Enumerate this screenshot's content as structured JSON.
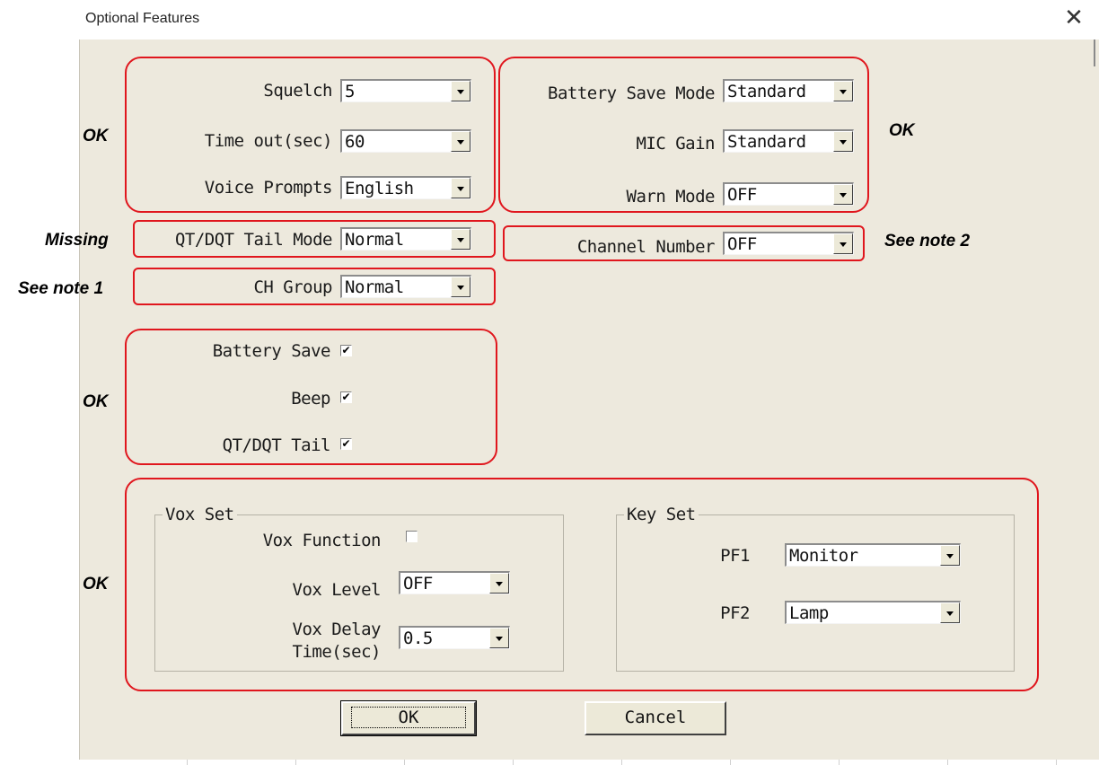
{
  "window": {
    "title": "Optional Features",
    "close_symbol": "✕"
  },
  "fields": {
    "squelch": {
      "label": "Squelch",
      "value": "5"
    },
    "timeout": {
      "label": "Time out(sec)",
      "value": "60"
    },
    "voice_prompts": {
      "label": "Voice Prompts",
      "value": "English"
    },
    "qt_tail_mode": {
      "label": "QT/DQT Tail Mode",
      "value": "Normal"
    },
    "ch_group": {
      "label": "CH Group",
      "value": "Normal"
    },
    "battery_save_mode": {
      "label": "Battery Save Mode",
      "value": "Standard"
    },
    "mic_gain": {
      "label": "MIC Gain",
      "value": "Standard"
    },
    "warn_mode": {
      "label": "Warn Mode",
      "value": "OFF"
    },
    "channel_number": {
      "label": "Channel Number",
      "value": "OFF"
    }
  },
  "checkboxes": {
    "battery_save": {
      "label": "Battery Save",
      "checked": true
    },
    "beep": {
      "label": "Beep",
      "checked": true
    },
    "qt_tail": {
      "label": "QT/DQT Tail",
      "checked": true
    }
  },
  "vox_set": {
    "legend": "Vox Set",
    "vox_function": {
      "label": "Vox Function",
      "checked": false
    },
    "vox_level": {
      "label": "Vox Level",
      "value": "OFF"
    },
    "vox_delay": {
      "label_line1": "Vox Delay",
      "label_line2": "Time(sec)",
      "value": "0.5"
    }
  },
  "key_set": {
    "legend": "Key Set",
    "pf1": {
      "label": "PF1",
      "value": "Monitor"
    },
    "pf2": {
      "label": "PF2",
      "value": "Lamp"
    }
  },
  "buttons": {
    "ok": "OK",
    "cancel": "Cancel"
  },
  "annotations": {
    "top_left": "OK",
    "top_right": "OK",
    "missing": "Missing",
    "note1": "See note 1",
    "note2": "See note 2",
    "checkboxes": "OK",
    "bottom": "OK"
  },
  "colors": {
    "annotation_red": "#e0161d",
    "dialog_bg": "#ede9dd"
  }
}
